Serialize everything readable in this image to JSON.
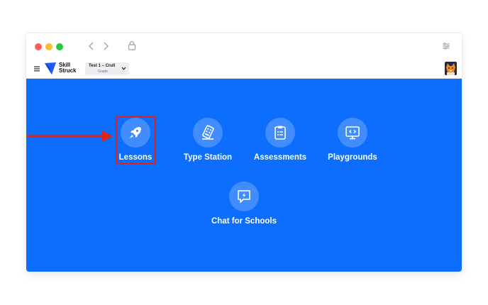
{
  "window": {
    "nav": {
      "back_icon": "chevron-left-icon",
      "forward_icon": "chevron-right-icon",
      "lock_icon": "lock-icon",
      "settings_icon": "sliders-icon"
    }
  },
  "appbar": {
    "logo_line1": "Skill",
    "logo_line2": "Struck",
    "class_select": {
      "name": "Test 1 – Crull",
      "sub": "Grade"
    }
  },
  "tiles": [
    {
      "label": "Lessons",
      "icon": "rocket-icon"
    },
    {
      "label": "Type Station",
      "icon": "keyboard-icon"
    },
    {
      "label": "Assessments",
      "icon": "clipboard-icon"
    },
    {
      "label": "Playgrounds",
      "icon": "monitor-code-icon"
    },
    {
      "label": "Chat for Schools",
      "icon": "chat-bolt-icon"
    }
  ],
  "colors": {
    "brand_blue": "#0d6efd",
    "highlight_red": "#e0241c"
  }
}
